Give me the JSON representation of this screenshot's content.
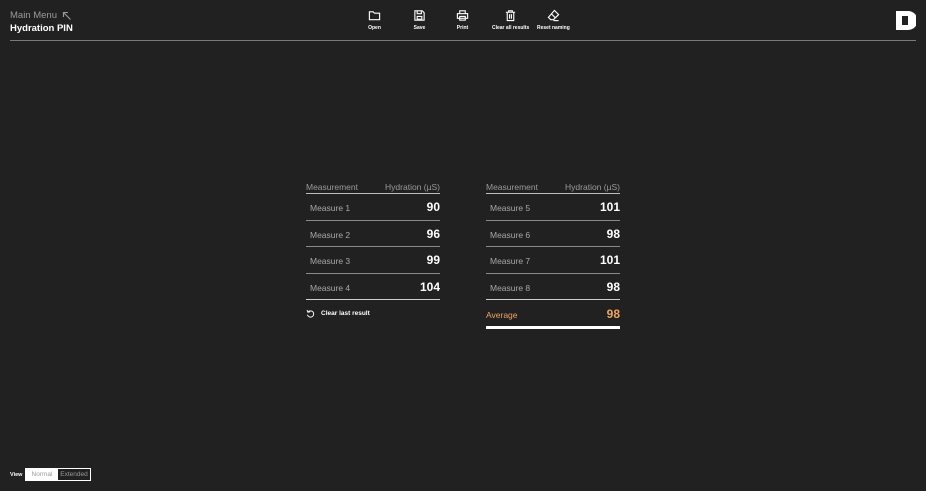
{
  "header": {
    "breadcrumb": "Main Menu",
    "title": "Hydration PIN"
  },
  "toolbar": {
    "open": "Open",
    "save": "Save",
    "print": "Print",
    "clear_all": "Clear all results",
    "reset_naming": "Reset naming"
  },
  "table_left": {
    "col_measurement": "Measurement",
    "col_hydration": "Hydration (µS)",
    "rows": [
      {
        "name": "Measure 1",
        "value": "90"
      },
      {
        "name": "Measure 2",
        "value": "96"
      },
      {
        "name": "Measure 3",
        "value": "99"
      },
      {
        "name": "Measure 4",
        "value": "104"
      }
    ]
  },
  "table_right": {
    "col_measurement": "Measurement",
    "col_hydration": "Hydration (µS)",
    "rows": [
      {
        "name": "Measure 5",
        "value": "101"
      },
      {
        "name": "Measure 6",
        "value": "98"
      },
      {
        "name": "Measure 7",
        "value": "101"
      },
      {
        "name": "Measure 8",
        "value": "98"
      }
    ]
  },
  "clear_last": "Clear last result",
  "average": {
    "label": "Average",
    "value": "98",
    "color": "#f0a55a"
  },
  "view": {
    "label": "View",
    "options": [
      "Normal",
      "Extended"
    ],
    "selected": "Normal"
  },
  "icons": {
    "breadcrumb": "arrow-up-left-icon",
    "open": "folder-icon",
    "save": "floppy-disk-icon",
    "print": "printer-icon",
    "clear_all": "trash-icon",
    "reset_naming": "eraser-icon",
    "clear_last": "undo-icon",
    "logo": "brand-logo"
  }
}
